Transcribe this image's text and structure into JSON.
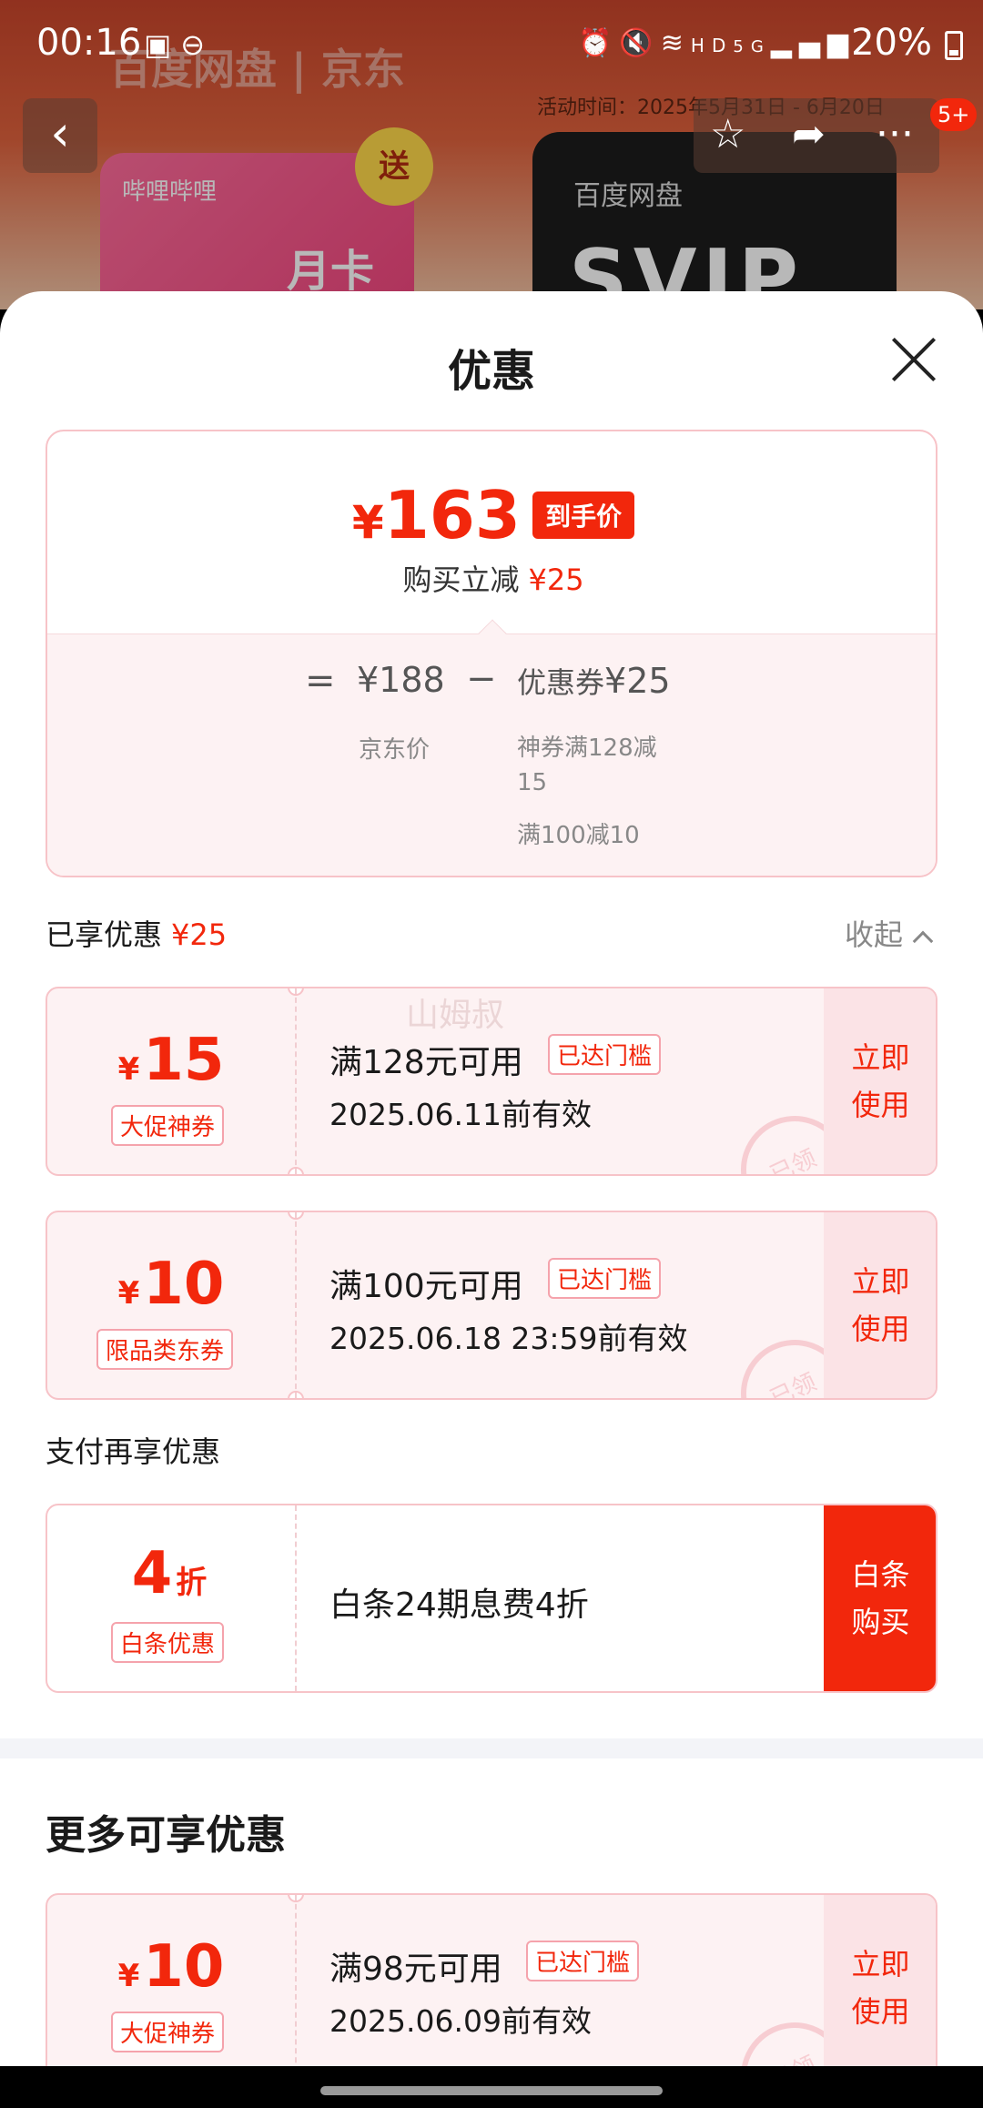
{
  "status_bar": {
    "time": "00:16",
    "battery": "20%",
    "network": "5G",
    "hd": "HD"
  },
  "background": {
    "logo_text": "百度网盘 | 京东",
    "activity_time": "活动时间：2025年5月31日 - 6月20日",
    "card1_brand": "哔哩哔哩",
    "card1_label": "月卡",
    "card2_brand": "百度网盘",
    "card2_label": "SVIP",
    "gift_label": "送",
    "cart_badge": "5+"
  },
  "sheet": {
    "title": "优惠"
  },
  "price_summary": {
    "final_price": "163",
    "currency": "¥",
    "final_label": "到手价",
    "saving_label": "购买立减",
    "saving_amount": "¥25",
    "equals": "=",
    "jd_price": "¥188",
    "minus": "−",
    "coupon_label": "优惠券",
    "coupon_amount": "¥25",
    "jd_price_label": "京东价",
    "coupon_detail_1": "神券满128减15",
    "coupon_detail_2": "满100减10"
  },
  "enjoyed": {
    "label": "已享优惠",
    "amount": "¥25",
    "collapse_label": "收起"
  },
  "watermark": "山姆叔",
  "coupons_enjoyed": [
    {
      "amount": "15",
      "symbol": "¥",
      "type": "大促神券",
      "condition": "满128元可用",
      "threshold_tag": "已达门槛",
      "validity": "2025.06.11前有效",
      "action": "立即\n使用",
      "stamp": "已领"
    },
    {
      "amount": "10",
      "symbol": "¥",
      "type": "限品类东券",
      "condition": "满100元可用",
      "threshold_tag": "已达门槛",
      "validity": "2025.06.18 23:59前有效",
      "action": "立即\n使用",
      "stamp": "已领"
    }
  ],
  "payment": {
    "section_label": "支付再享优惠",
    "amount": "4",
    "unit": "折",
    "type": "白条优惠",
    "description": "白条24期息费4折",
    "action": "白条\n购买"
  },
  "more": {
    "title": "更多可享优惠",
    "coupon": {
      "amount": "10",
      "symbol": "¥",
      "type": "大促神券",
      "condition": "满98元可用",
      "threshold_tag": "已达门槛",
      "validity": "2025.06.09前有效",
      "action": "立即\n使用",
      "stamp": "已领"
    }
  },
  "colors": {
    "accent": "#f2270c",
    "coupon_bg": "#fdf2f3",
    "coupon_border": "#f7c3c8"
  }
}
